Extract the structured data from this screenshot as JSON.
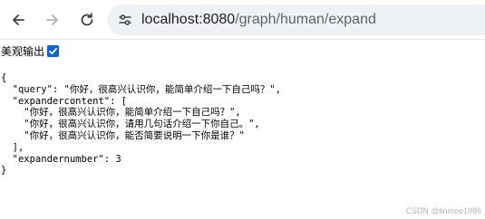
{
  "browser": {
    "url_host": "localhost:8080",
    "url_path": "/graph/human/expand"
  },
  "pretty_print": {
    "label": "美观输出",
    "checked": true
  },
  "json_lines": [
    "{",
    "  \"query\": \"你好，很高兴认识你，能简单介绍一下自己吗？\",",
    "  \"expandercontent\": [",
    "    \"你好，很高兴认识你，能简单介绍一下自己吗？\",",
    "    \"你好，很高兴认识你，请用几句话介绍一下你自己。\",",
    "    \"你好，很高兴认识你，能否简要说明一下你是谁？\"",
    "  ],",
    "  \"expandernumber\": 3",
    "}"
  ],
  "watermark": "CSDN @linmoo1986",
  "icons": {
    "back": "arrow-left-icon",
    "forward": "arrow-right-icon",
    "reload": "reload-icon",
    "site_info": "tune-icon",
    "checkbox": "checkmark-icon"
  },
  "colors": {
    "checkbox": "#0b63d6",
    "omnibox": "#eef1f6"
  }
}
